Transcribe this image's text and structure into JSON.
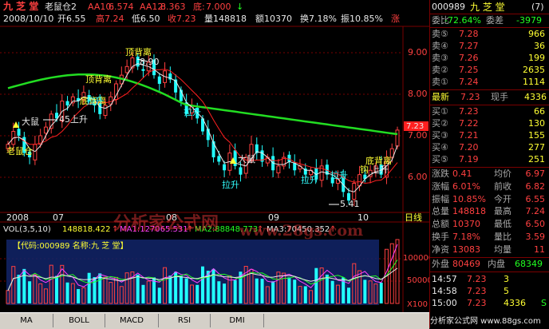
{
  "header": {
    "stock_name": "九 芝 堂",
    "indicator": "老鼠仓2",
    "aa10_label": "AA10:",
    "aa10_value": "6.574",
    "aa12_label": "AA12:",
    "aa12_value": "8.363",
    "bottom_label": "底:",
    "bottom_value": "7.000",
    "bottom_arrow": "↓",
    "date": "2008/10/10",
    "open": "开6.55",
    "high": "高7.24",
    "low": "低6.50",
    "close": "收7.23",
    "volume": "量148818",
    "amount": "额10370",
    "turnover": "换7.18%",
    "amplitude": "振10.85%",
    "change_label": "涨"
  },
  "price_axis": [
    "9.00",
    "8.00",
    "7.00",
    "6.00"
  ],
  "current_price_tag": "7.23",
  "date_axis": [
    "2008",
    "07",
    "08",
    "09",
    "10"
  ],
  "axis_mode": "日线",
  "annotations": {
    "peak_value": "8.90",
    "low_value": "5.41",
    "top_div_1": "顶背离",
    "top_div_2": "顶背离",
    "bottom_div_1": "底背离",
    "bottom_div_2": "底背离",
    "rat_1": "老鼠仓",
    "big_rat_1": "大鼠",
    "big_rat_2": "大鼠",
    "up_45": "45上升",
    "lashen_1": "拉升",
    "lashen_2": "拉升",
    "lashen_3": "拉升",
    "lashen_4": "拉升",
    "lashen_5": "拉升",
    "up_short": "上升",
    "gou": "钩"
  },
  "vol": {
    "title": "VOL(3,5,10)",
    "v": "148818.422",
    "v_arrow": "↑",
    "ma1": "MA1:127065.531",
    "ma1_arrow": "↑",
    "ma2": "MA2:88848.773",
    "ma2_arrow": "↑",
    "ma3": "MA3:70450.352",
    "ma3_arrow": "↑",
    "axis": [
      "100000",
      "50000",
      "X100"
    ]
  },
  "inner_panel": {
    "label": "【代码:000989 名称:九 芝 堂】"
  },
  "watermark": {
    "big": "分析家公式网",
    "url": "www.28gs.com",
    "footer": "分析家公式网 www.88gs.com"
  },
  "sidebar": {
    "code": "000989",
    "name": "九 芝 堂",
    "badge": "(7)",
    "weibi_label": "委比",
    "weibi_value": "-72.64%",
    "weicha_label": "委差",
    "weicha_value": "-3979",
    "sells": [
      {
        "label": "卖⑤",
        "price": "7.28",
        "vol": "966"
      },
      {
        "label": "卖④",
        "price": "7.27",
        "vol": "36"
      },
      {
        "label": "卖③",
        "price": "7.26",
        "vol": "199"
      },
      {
        "label": "卖②",
        "price": "7.25",
        "vol": "2635"
      },
      {
        "label": "卖①",
        "price": "7.24",
        "vol": "1114"
      }
    ],
    "latest_label": "最新",
    "latest_price": "7.23",
    "latest_hand_label": "现手",
    "latest_hand": "4336",
    "buys": [
      {
        "label": "买①",
        "price": "7.23",
        "vol": "66"
      },
      {
        "label": "买②",
        "price": "7.22",
        "vol": "130"
      },
      {
        "label": "买③",
        "price": "7.21",
        "vol": "155"
      },
      {
        "label": "买④",
        "price": "7.20",
        "vol": "277"
      },
      {
        "label": "买⑤",
        "price": "7.19",
        "vol": "251"
      }
    ],
    "stats": [
      {
        "l1": "涨跌",
        "v1": "0.41",
        "l2": "均价",
        "v2": "6.97"
      },
      {
        "l1": "涨幅",
        "v1": "6.01%",
        "l2": "前收",
        "v2": "6.82"
      },
      {
        "l1": "振幅",
        "v1": "10.85%",
        "l2": "今开",
        "v2": "6.55"
      },
      {
        "l1": "总量",
        "v1": "148818",
        "l2": "最高",
        "v2": "7.24"
      },
      {
        "l1": "总额",
        "v1": "10370",
        "l2": "最低",
        "v2": "6.50"
      },
      {
        "l1": "换手",
        "v1": "7.18%",
        "l2": "量比",
        "v2": "3.59"
      },
      {
        "l1": "净资",
        "v1": "13083",
        "l2": "均量",
        "v2": "11"
      }
    ],
    "outer_label": "外盘",
    "outer_value": "80469",
    "inner_label": "内盘",
    "inner_value": "68349",
    "ticks": [
      {
        "time": "14:57",
        "price": "7.23",
        "vol": "3",
        "flag": ""
      },
      {
        "time": "14:58",
        "price": "7.23",
        "vol": "5",
        "flag": ""
      },
      {
        "time": "15:00",
        "price": "7.23",
        "vol": "4336",
        "flag": "S"
      }
    ]
  },
  "tabs": [
    "MA",
    "BOLL",
    "MACD",
    "RSI",
    "DMI"
  ],
  "colors": {
    "up": "#ff4040",
    "down": "#22ffff",
    "ma_long": "#22dd22",
    "ma_short": "#ff2020",
    "ma_mid": "#e8e8e8"
  },
  "chart_data": {
    "type": "candlestick",
    "title": "九 芝 堂",
    "ylim": [
      5.4,
      9.5
    ],
    "closes": [
      6.9,
      7.2,
      7.1,
      6.7,
      6.6,
      6.9,
      7.1,
      7.3,
      7.6,
      7.5,
      7.9,
      7.8,
      8.0,
      7.9,
      8.1,
      7.9,
      7.8,
      7.6,
      7.8,
      8.0,
      8.3,
      8.5,
      8.7,
      8.9,
      8.7,
      8.6,
      8.8,
      8.5,
      8.3,
      8.6,
      8.4,
      8.1,
      7.9,
      7.6,
      7.8,
      7.5,
      7.2,
      7.0,
      6.6,
      6.5,
      6.3,
      6.7,
      6.4,
      6.2,
      6.6,
      6.9,
      6.7,
      6.5,
      6.6,
      6.3,
      6.4,
      6.6,
      6.5,
      6.3,
      6.4,
      6.2,
      6.3,
      6.1,
      6.4,
      6.2,
      6.0,
      6.1,
      5.8,
      5.6,
      6.0,
      6.2,
      6.1,
      6.3,
      6.4,
      6.2,
      6.6,
      6.8,
      7.23
    ]
  }
}
